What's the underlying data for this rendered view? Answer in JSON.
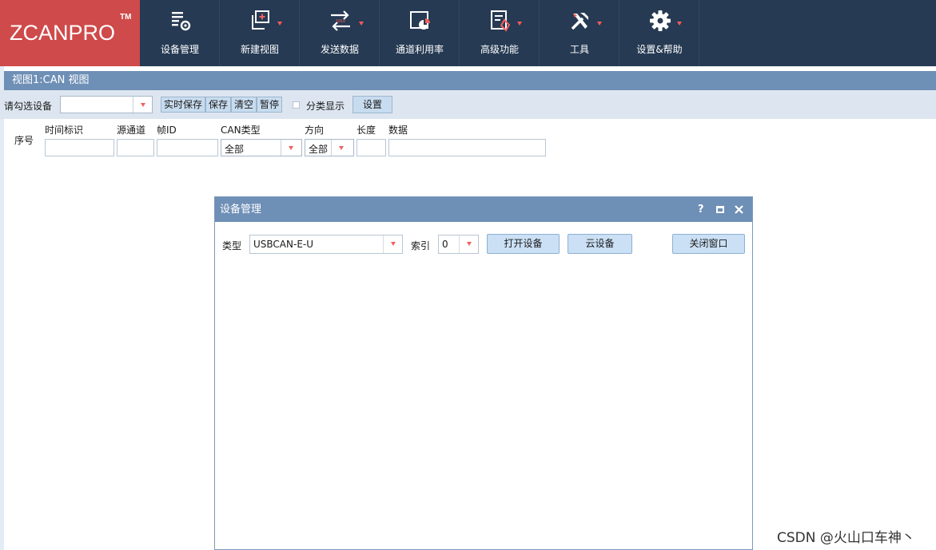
{
  "app": {
    "logo_text": "ZCANPRO",
    "logo_tm": "TM"
  },
  "toolbar": [
    {
      "label": "设备管理",
      "icon": "device-manage-icon",
      "has_dropdown": false
    },
    {
      "label": "新建视图",
      "icon": "new-view-icon",
      "has_dropdown": true
    },
    {
      "label": "发送数据",
      "icon": "send-data-icon",
      "has_dropdown": true
    },
    {
      "label": "通道利用率",
      "icon": "channel-usage-icon",
      "has_dropdown": false
    },
    {
      "label": "高级功能",
      "icon": "advanced-icon",
      "has_dropdown": true
    },
    {
      "label": "工具",
      "icon": "tools-icon",
      "has_dropdown": true
    },
    {
      "label": "设置&帮助",
      "icon": "gear-icon",
      "has_dropdown": true
    }
  ],
  "view": {
    "title": "视图1:CAN 视图",
    "select_device_label": "请勾选设备",
    "device_value": "",
    "buttons": {
      "realtime_save": "实时保存",
      "save": "保存",
      "clear": "清空",
      "pause": "暂停",
      "settings": "设置"
    },
    "category_display_label": "分类显示",
    "category_display_checked": false
  },
  "columns": {
    "index": "序号",
    "timestamp": "时间标识",
    "source_channel": "源通道",
    "frame_id": "帧ID",
    "can_type": "CAN类型",
    "direction": "方向",
    "length": "长度",
    "data": "数据"
  },
  "filters": {
    "can_type_value": "全部",
    "direction_value": "全部"
  },
  "dialog": {
    "title": "设备管理",
    "help": "?",
    "type_label": "类型",
    "type_value": "USBCAN-E-U",
    "index_label": "索引",
    "index_value": "0",
    "open_device": "打开设备",
    "cloud_device": "云设备",
    "close_window": "关闭窗口"
  },
  "watermark": "CSDN @火山口车神丶",
  "colors": {
    "topbar": "#263a53",
    "logo_bg": "#cf4a4a",
    "header_blue": "#6e8fb6",
    "accent_red": "#f26060",
    "button_blue": "#cbe0f5"
  }
}
